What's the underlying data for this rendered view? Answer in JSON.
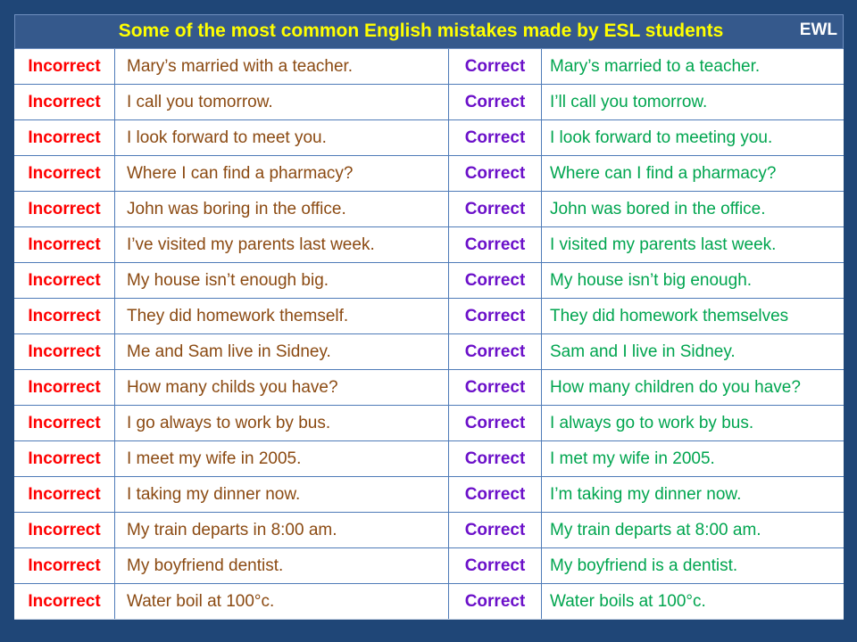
{
  "header": {
    "title": "Some of the most common English mistakes made by ESL students",
    "brand": "EWL"
  },
  "labels": {
    "incorrect": "Incorrect",
    "correct": "Correct"
  },
  "colors": {
    "background": "#1f4677",
    "header_bg": "#35598c",
    "title": "#ffff00",
    "incorrect_label": "#ff0000",
    "incorrect_text": "#8b4a12",
    "correct_label": "#6b10c9",
    "correct_text": "#00a54f"
  },
  "rows": [
    {
      "incorrect": "Mary’s married with a teacher.",
      "correct": "Mary’s married to a teacher."
    },
    {
      "incorrect": "I call you tomorrow.",
      "correct": "I’ll call you tomorrow."
    },
    {
      "incorrect": "I look forward to meet you.",
      "correct": "I look forward to meeting you."
    },
    {
      "incorrect": "Where I can find a pharmacy?",
      "correct": "Where can I find a pharmacy?"
    },
    {
      "incorrect": "John was boring in the office.",
      "correct": "John was bored in the office."
    },
    {
      "incorrect": "I’ve visited my parents last week.",
      "correct": "I visited my parents last week."
    },
    {
      "incorrect": "My house isn’t enough big.",
      "correct": "My house isn’t big enough."
    },
    {
      "incorrect": "They did homework themself.",
      "correct": "They did homework themselves"
    },
    {
      "incorrect": "Me and Sam live in Sidney.",
      "correct": "Sam and I live in Sidney."
    },
    {
      "incorrect": "How many childs you have?",
      "correct": "How many children do you have?"
    },
    {
      "incorrect": "I go always to work by bus.",
      "correct": "I always go to work by bus."
    },
    {
      "incorrect": "I meet my wife in 2005.",
      "correct": "I met my wife in 2005."
    },
    {
      "incorrect": "I taking my dinner now.",
      "correct": "I’m taking my dinner now."
    },
    {
      "incorrect": "My train departs in 8:00 am.",
      "correct": "My train departs at 8:00 am."
    },
    {
      "incorrect": "My boyfriend dentist.",
      "correct": "My boyfriend is a dentist."
    },
    {
      "incorrect": "Water boil at 100°c.",
      "correct": "Water boils at 100°c."
    }
  ]
}
